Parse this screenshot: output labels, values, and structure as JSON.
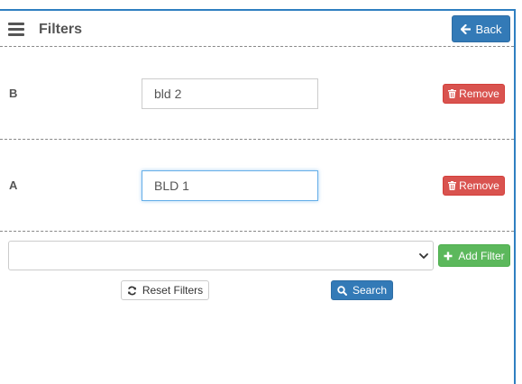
{
  "header": {
    "title": "Filters",
    "back_label": "Back"
  },
  "filters": [
    {
      "label": "B",
      "value": "bld 2",
      "remove_label": "Remove"
    },
    {
      "label": "A",
      "value": "BLD 1",
      "remove_label": "Remove"
    }
  ],
  "add_filter": {
    "selected": "",
    "button_label": "Add Filter"
  },
  "actions": {
    "reset_label": "Reset Filters",
    "search_label": "Search"
  },
  "colors": {
    "primary": "#337ab7",
    "danger": "#d9534f",
    "success": "#5cb85c",
    "frame": "#2f7fc1"
  },
  "icons": [
    "hamburger-icon",
    "arrow-left-icon",
    "trash-icon",
    "plus-icon",
    "refresh-icon",
    "search-icon",
    "chevron-down-icon"
  ]
}
